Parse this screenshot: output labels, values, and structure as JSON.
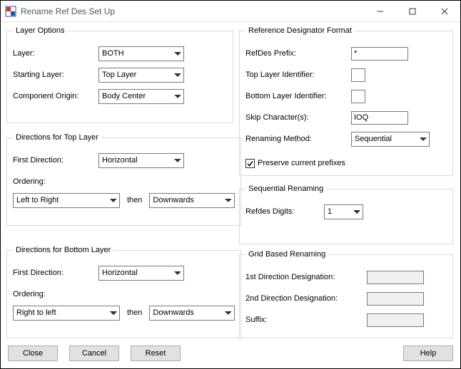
{
  "title": "Rename Ref Des Set Up",
  "layerOptions": {
    "legend": "Layer Options",
    "layerLabel": "Layer:",
    "layerValue": "BOTH",
    "startingLayerLabel": "Starting Layer:",
    "startingLayerValue": "Top Layer",
    "componentOriginLabel": "Component Origin:",
    "componentOriginValue": "Body Center"
  },
  "dirTop": {
    "legend": "Directions for Top Layer",
    "firstDirLabel": "First Direction:",
    "firstDirValue": "Horizontal",
    "orderingLabel": "Ordering:",
    "orderVal1": "Left to Right",
    "then": "then",
    "orderVal2": "Downwards"
  },
  "dirBottom": {
    "legend": "Directions for Bottom Layer",
    "firstDirLabel": "First Direction:",
    "firstDirValue": "Horizontal",
    "orderingLabel": "Ordering:",
    "orderVal1": "Right to left",
    "then": "then",
    "orderVal2": "Downwards"
  },
  "refFormat": {
    "legend": "Reference Designator Format",
    "prefixLabel": "RefDes Prefix:",
    "prefixValue": "*",
    "topIdLabel": "Top Layer Identifier:",
    "topIdValue": "",
    "botIdLabel": "Bottom Layer Identifier:",
    "botIdValue": "",
    "skipLabel": "Skip Character(s):",
    "skipValue": "IOQ",
    "methodLabel": "Renaming Method:",
    "methodValue": "Sequential",
    "preserveLabel": "Preserve current prefixes"
  },
  "seq": {
    "legend": "Sequential Renaming",
    "digitsLabel": "Refdes Digits:",
    "digitsValue": "1"
  },
  "grid": {
    "legend": "Grid Based Renaming",
    "d1Label": "1st Direction Designation:",
    "d2Label": "2nd Direction Designation:",
    "suffixLabel": "Suffix:"
  },
  "buttons": {
    "close": "Close",
    "cancel": "Cancel",
    "reset": "Reset",
    "help": "Help"
  }
}
